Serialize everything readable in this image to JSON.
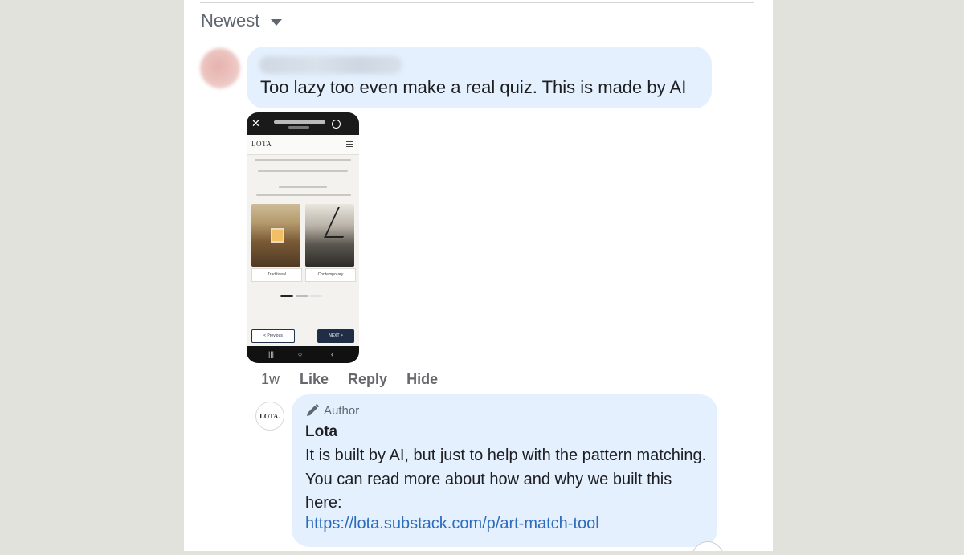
{
  "sort": {
    "label": "Newest"
  },
  "comment": {
    "text": "Too lazy too even make a real quiz. This is made by AI",
    "attachment": {
      "logo": "LOTA",
      "choice_left": "Traditional",
      "choice_right": "Contemporary",
      "prev_label": "< Previous",
      "next_label": "NEXT >"
    },
    "actions": {
      "time": "1w",
      "like": "Like",
      "reply": "Reply",
      "hide": "Hide"
    }
  },
  "reply": {
    "avatar_text": "LOTA.",
    "badge": "Author",
    "badge_icon": "pen-icon",
    "author": "Lota",
    "text": "It is built by AI, but just to help with the pattern matching. You can read more about how and why we built this here:",
    "link": "https://lota.substack.com/p/art-match-tool"
  },
  "colors": {
    "bubble": "#e4f0fd",
    "link": "#2d6bbd",
    "muted": "#65676b",
    "background": "#e2e2dd"
  }
}
